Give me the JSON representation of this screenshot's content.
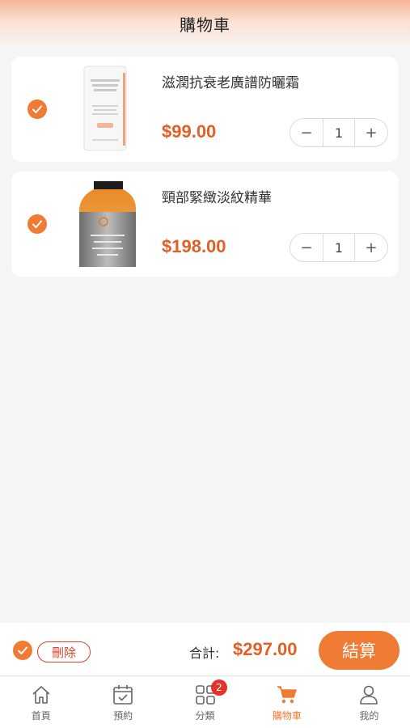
{
  "header": {
    "title": "購物車"
  },
  "cart_items": [
    {
      "name": "滋潤抗衰老廣譜防曬霜",
      "price": "$99.00",
      "quantity": "1",
      "selected": true
    },
    {
      "name": "頸部緊緻淡紋精華",
      "price": "$198.00",
      "quantity": "1",
      "selected": true
    }
  ],
  "stepper": {
    "minus": "−",
    "plus": "+"
  },
  "footer": {
    "delete_label": "刪除",
    "total_label": "合計:",
    "total_value": "$297.00",
    "checkout_label": "結算"
  },
  "tabbar": {
    "items": [
      {
        "label": "首頁",
        "icon": "home-icon"
      },
      {
        "label": "預約",
        "icon": "calendar-check-icon"
      },
      {
        "label": "分類",
        "icon": "grid-icon",
        "badge": "2"
      },
      {
        "label": "購物車",
        "icon": "cart-icon",
        "active": true
      },
      {
        "label": "我的",
        "icon": "user-icon"
      }
    ]
  },
  "colors": {
    "accent": "#ef7b35",
    "price": "#e25f26",
    "danger": "#d9442b",
    "badge": "#e5322d"
  }
}
